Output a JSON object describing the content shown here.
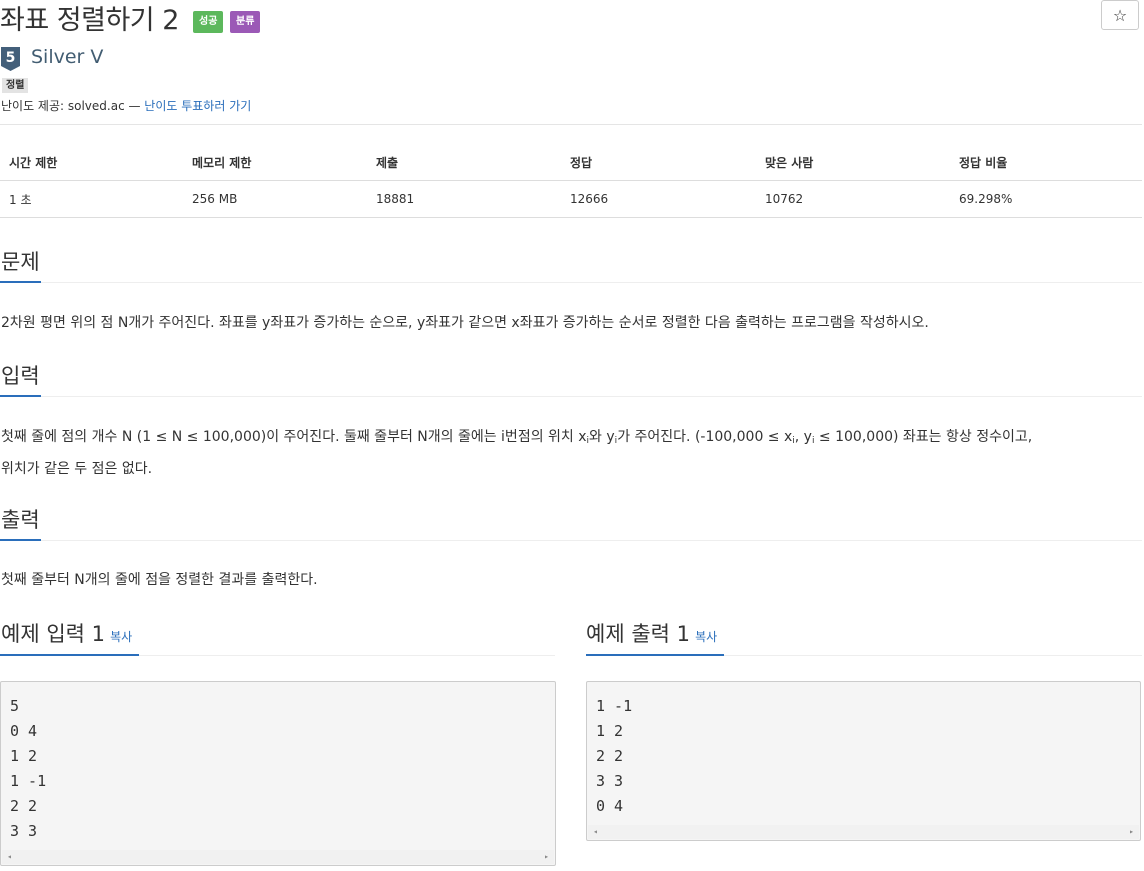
{
  "problem": {
    "title": "좌표 정렬하기 2",
    "badges": {
      "success": "성공",
      "category": "분류"
    },
    "favorite_icon": "☆",
    "tier": {
      "label": "Silver V",
      "number": "5",
      "color": "#435f7a"
    },
    "tag": "정렬",
    "credit_prefix": "난이도 제공: solved.ac — ",
    "credit_link": "난이도 투표하러 가기"
  },
  "info_table": {
    "headers": [
      "시간 제한",
      "메모리 제한",
      "제출",
      "정답",
      "맞은 사람",
      "정답 비율"
    ],
    "row": [
      "1 초",
      "256 MB",
      "18881",
      "12666",
      "10762",
      "69.298%"
    ]
  },
  "sections": {
    "problem_heading": "문제",
    "problem_text": "2차원 평면 위의 점 N개가 주어진다. 좌표를 y좌표가 증가하는 순으로, y좌표가 같으면 x좌표가 증가하는 순서로 정렬한 다음 출력하는 프로그램을 작성하시오.",
    "input_heading": "입력",
    "input_text_1": "첫째 줄에 점의 개수 N (1 ≤ N ≤ 100,000)이 주어진다. 둘째 줄부터 N개의 줄에는 i번점의 위치 x",
    "input_sub_i": "i",
    "input_text_2": "와 y",
    "input_text_3": "가 주어진다. (-100,000 ≤ x",
    "input_text_4": ", y",
    "input_text_5": " ≤ 100,000) 좌표는 항상 정수이고,",
    "input_text_6": "위치가 같은 두 점은 없다.",
    "output_heading": "출력",
    "output_text": "첫째 줄부터 N개의 줄에 점을 정렬한 결과를 출력한다."
  },
  "examples": {
    "input_title": "예제 입력 1",
    "output_title": "예제 출력 1",
    "copy_label": "복사",
    "input_lines": "5\n0 4\n1 2\n1 -1\n2 2\n3 3",
    "output_lines": "1 -1\n1 2\n2 2\n3 3\n0 4",
    "scroll_left": "◂",
    "scroll_right": "▸"
  }
}
